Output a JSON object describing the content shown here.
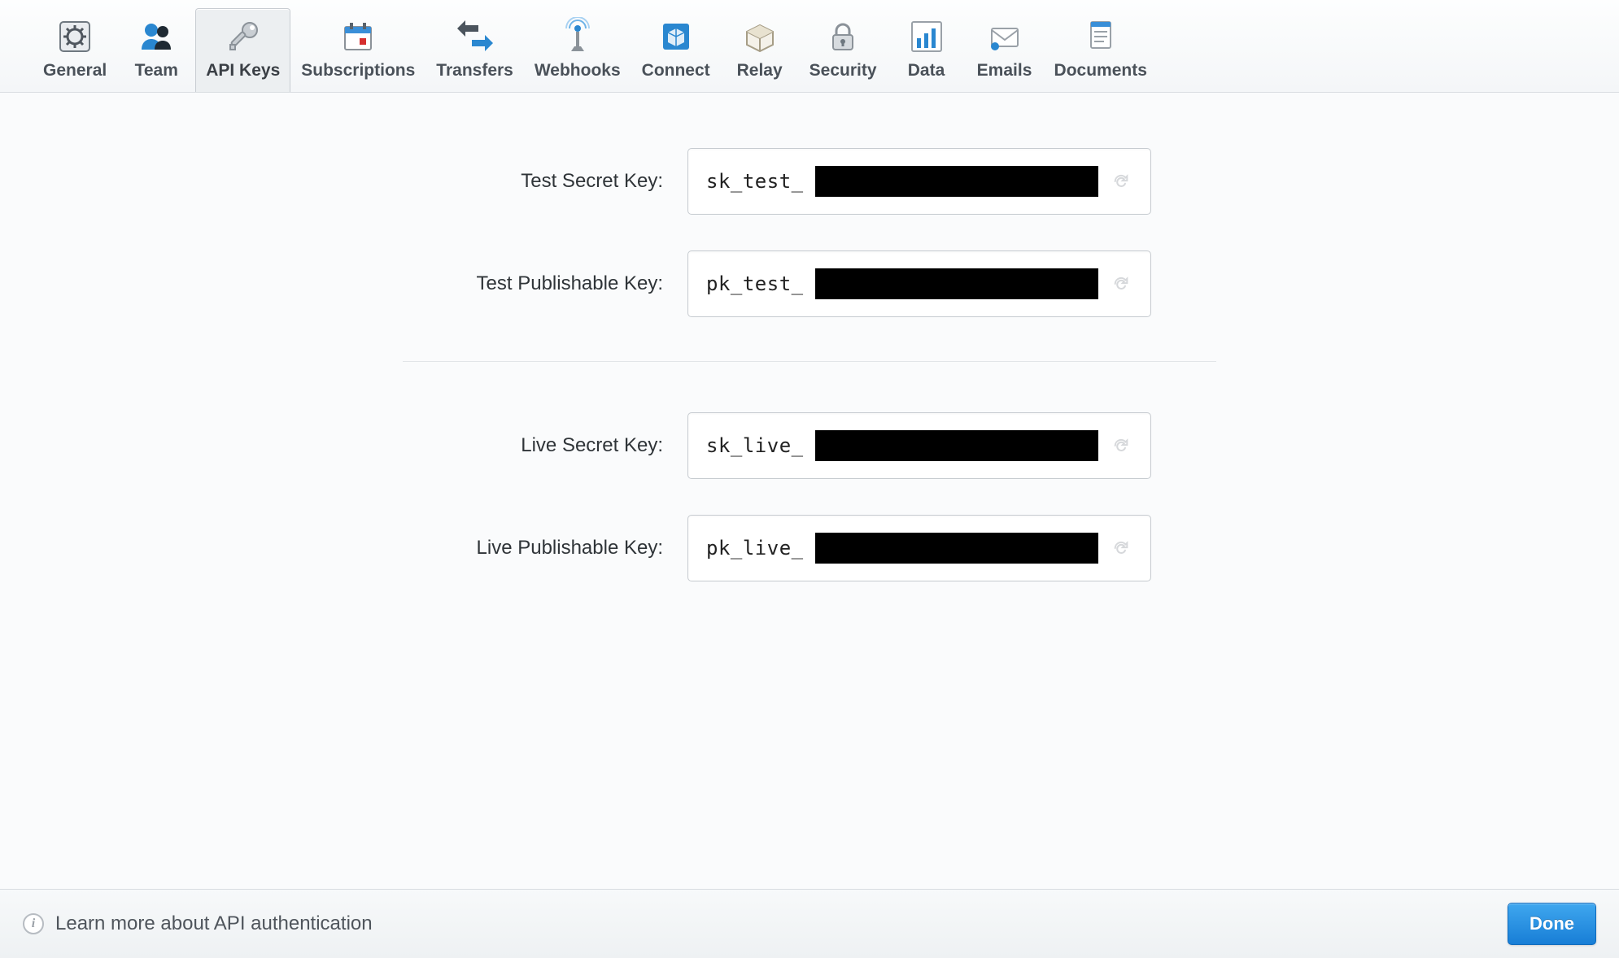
{
  "toolbar": {
    "items": [
      {
        "id": "general",
        "label": "General",
        "icon": "gear-icon"
      },
      {
        "id": "team",
        "label": "Team",
        "icon": "team-icon"
      },
      {
        "id": "apikeys",
        "label": "API Keys",
        "icon": "key-icon"
      },
      {
        "id": "subscriptions",
        "label": "Subscriptions",
        "icon": "calendar-icon"
      },
      {
        "id": "transfers",
        "label": "Transfers",
        "icon": "transfers-icon"
      },
      {
        "id": "webhooks",
        "label": "Webhooks",
        "icon": "antenna-icon"
      },
      {
        "id": "connect",
        "label": "Connect",
        "icon": "cube-icon"
      },
      {
        "id": "relay",
        "label": "Relay",
        "icon": "box-icon"
      },
      {
        "id": "security",
        "label": "Security",
        "icon": "lock-icon"
      },
      {
        "id": "data",
        "label": "Data",
        "icon": "chart-icon"
      },
      {
        "id": "emails",
        "label": "Emails",
        "icon": "envelope-icon"
      },
      {
        "id": "documents",
        "label": "Documents",
        "icon": "document-icon"
      }
    ],
    "active_id": "apikeys"
  },
  "keys": {
    "groups": [
      {
        "rows": [
          {
            "id": "test-secret",
            "label": "Test Secret Key:",
            "prefix": "sk_test_"
          },
          {
            "id": "test-publishable",
            "label": "Test Publishable Key:",
            "prefix": "pk_test_"
          }
        ]
      },
      {
        "rows": [
          {
            "id": "live-secret",
            "label": "Live Secret Key:",
            "prefix": "sk_live_"
          },
          {
            "id": "live-publishable",
            "label": "Live Publishable Key:",
            "prefix": "pk_live_"
          }
        ]
      }
    ]
  },
  "footer": {
    "learn_more": "Learn more about API authentication",
    "done_label": "Done"
  }
}
